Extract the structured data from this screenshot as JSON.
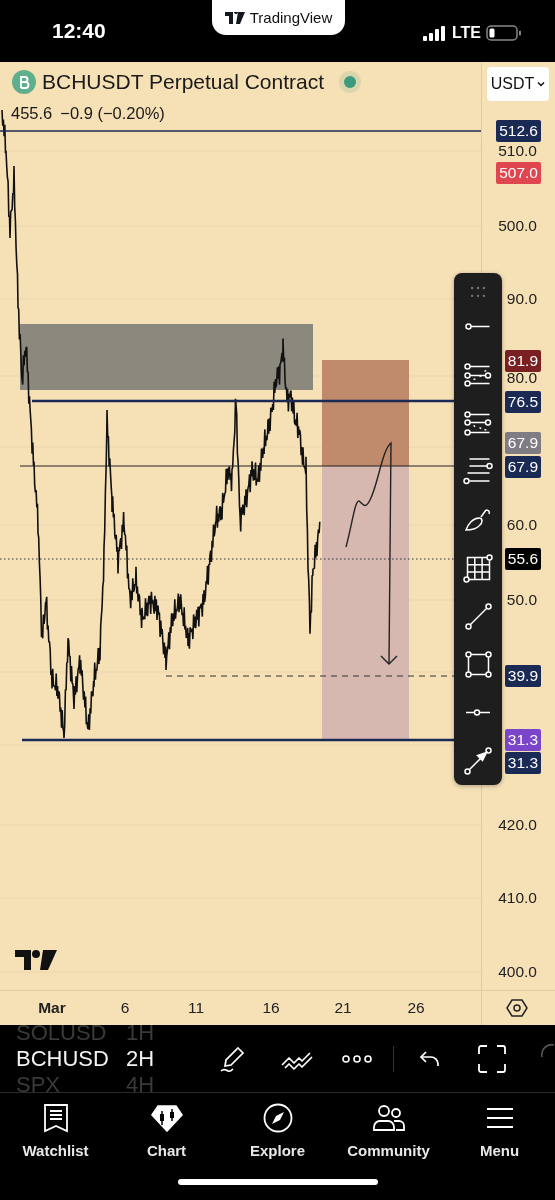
{
  "status_bar": {
    "time": "12:40",
    "app_pill": "TradingView",
    "network": "LTE"
  },
  "chart": {
    "symbol": "BCHUSDT Perpetual Contract",
    "price": "455.6",
    "change": "−0.9 (−0.20%)",
    "currency_button": "USDT",
    "price_axis": [
      {
        "text": "512.6",
        "kind": "badge",
        "color": "#1b2a55"
      },
      {
        "text": "510.0",
        "kind": "plain"
      },
      {
        "text": "507.0",
        "kind": "badge",
        "color": "#e0464f"
      },
      {
        "text": "500.0",
        "kind": "plain"
      },
      {
        "text": "90.0",
        "kind": "plain"
      },
      {
        "text": "81.9",
        "kind": "badge",
        "color": "#7a1f22"
      },
      {
        "text": "80.0",
        "kind": "plain"
      },
      {
        "text": "76.5",
        "kind": "badge",
        "color": "#1b2a55"
      },
      {
        "text": "67.9",
        "kind": "badge",
        "color": "#7f7c84"
      },
      {
        "text": "67.9",
        "kind": "badge",
        "color": "#1b2a55"
      },
      {
        "text": "60.0",
        "kind": "plain"
      },
      {
        "text": "55.6",
        "kind": "badge",
        "color": "#000000"
      },
      {
        "text": "50.0",
        "kind": "plain"
      },
      {
        "text": "39.9",
        "kind": "badge",
        "color": "#1b2a55"
      },
      {
        "text": "31.3",
        "kind": "badge",
        "color": "#7a45c9"
      },
      {
        "text": "31.3",
        "kind": "badge",
        "color": "#1b2a55"
      },
      {
        "text": "420.0",
        "kind": "plain"
      },
      {
        "text": "410.0",
        "kind": "plain"
      },
      {
        "text": "400.0",
        "kind": "plain"
      }
    ],
    "time_axis": [
      "Mar",
      "6",
      "11",
      "16",
      "21",
      "26"
    ]
  },
  "toolbar": {
    "symbols": [
      {
        "label": "SOLUSD",
        "interval": "1H",
        "selected": false
      },
      {
        "label": "BCHUSD",
        "interval": "2H",
        "selected": true
      },
      {
        "label": "SPX",
        "interval": "4H",
        "selected": false
      }
    ]
  },
  "tab_bar": {
    "tabs": [
      {
        "label": "Watchlist",
        "selected": false
      },
      {
        "label": "Chart",
        "selected": true
      },
      {
        "label": "Explore",
        "selected": false
      },
      {
        "label": "Community",
        "selected": false
      },
      {
        "label": "Menu",
        "selected": false
      }
    ]
  }
}
